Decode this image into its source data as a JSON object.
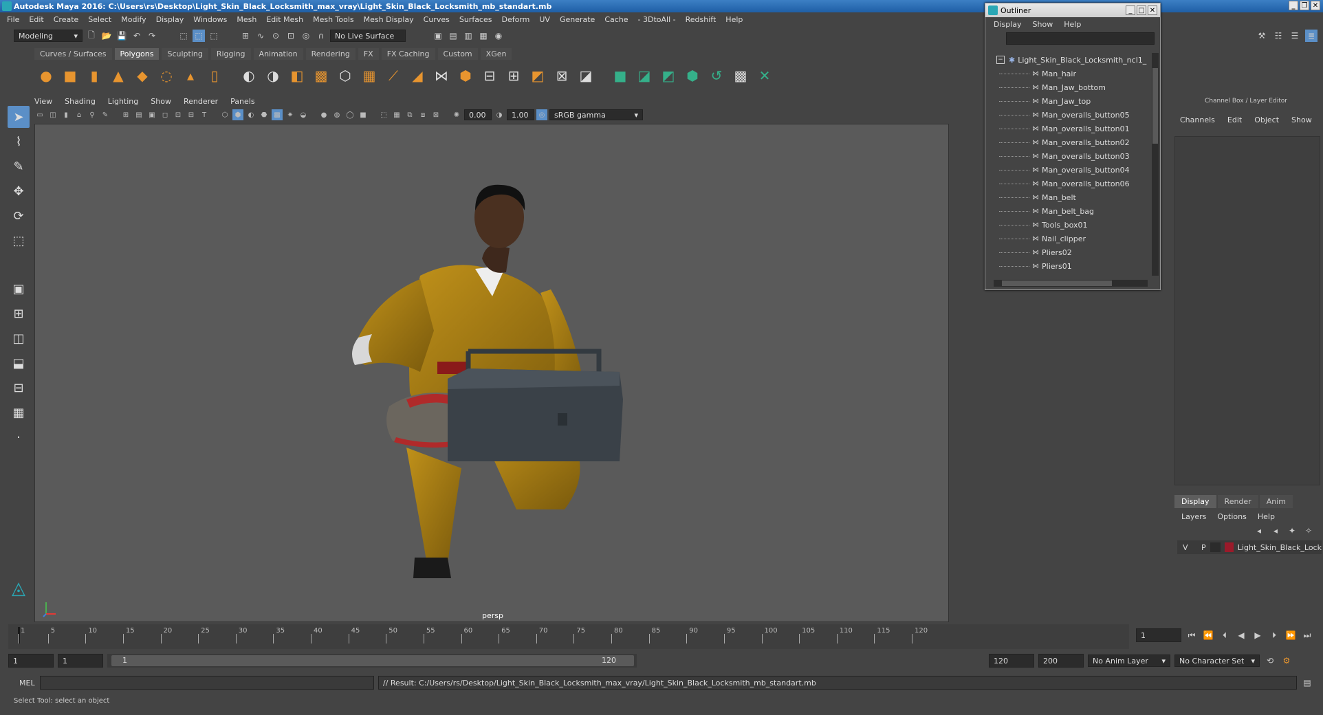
{
  "window": {
    "title": "Autodesk Maya 2016: C:\\Users\\rs\\Desktop\\Light_Skin_Black_Locksmith_max_vray\\Light_Skin_Black_Locksmith_mb_standart.mb"
  },
  "menu": [
    "File",
    "Edit",
    "Create",
    "Select",
    "Modify",
    "Display",
    "Windows",
    "Mesh",
    "Edit Mesh",
    "Mesh Tools",
    "Mesh Display",
    "Curves",
    "Surfaces",
    "Deform",
    "UV",
    "Generate",
    "Cache",
    "- 3DtoAll -",
    "Redshift",
    "Help"
  ],
  "status": {
    "mode": "Modeling",
    "live_surface": "No Live Surface"
  },
  "shelf_tabs": [
    "Curves / Surfaces",
    "Polygons",
    "Sculpting",
    "Rigging",
    "Animation",
    "Rendering",
    "FX",
    "FX Caching",
    "Custom",
    "XGen"
  ],
  "viewport": {
    "menu": [
      "View",
      "Shading",
      "Lighting",
      "Show",
      "Renderer",
      "Panels"
    ],
    "exposure": "0.00",
    "gamma": "1.00",
    "color_space": "sRGB gamma",
    "label": "persp"
  },
  "outliner": {
    "title": "Outliner",
    "menu": [
      "Display",
      "Show",
      "Help"
    ],
    "root": "Light_Skin_Black_Locksmith_ncl1_",
    "items": [
      "Man_hair",
      "Man_Jaw_bottom",
      "Man_Jaw_top",
      "Man_overalls_button05",
      "Man_overalls_button01",
      "Man_overalls_button02",
      "Man_overalls_button03",
      "Man_overalls_button04",
      "Man_overalls_button06",
      "Man_belt",
      "Man_belt_bag",
      "Tools_box01",
      "Nail_clipper",
      "Pliers02",
      "Pliers01"
    ]
  },
  "channel_box": {
    "title": "Channel Box / Layer Editor",
    "menu": [
      "Channels",
      "Edit",
      "Object",
      "Show"
    ]
  },
  "layer_editor": {
    "tabs": [
      "Display",
      "Render",
      "Anim"
    ],
    "menu": [
      "Layers",
      "Options",
      "Help"
    ],
    "layer": {
      "v": "V",
      "p": "P",
      "name": "Light_Skin_Black_Lock",
      "color": "#9a1a2a"
    }
  },
  "timeline": {
    "ticks": [
      "1",
      "5",
      "10",
      "15",
      "20",
      "25",
      "30",
      "35",
      "40",
      "45",
      "50",
      "55",
      "60",
      "65",
      "70",
      "75",
      "80",
      "85",
      "90",
      "95",
      "100",
      "105",
      "110",
      "115",
      "120"
    ],
    "current_frame": "1"
  },
  "range": {
    "start": "1",
    "start2": "1",
    "slider_start": "1",
    "slider_end": "120",
    "end": "120",
    "end2": "200",
    "anim_layer": "No Anim Layer",
    "char_set": "No Character Set"
  },
  "command": {
    "lang": "MEL",
    "result": "// Result: C:/Users/rs/Desktop/Light_Skin_Black_Locksmith_max_vray/Light_Skin_Black_Locksmith_mb_standart.mb"
  },
  "help": "Select Tool: select an object"
}
